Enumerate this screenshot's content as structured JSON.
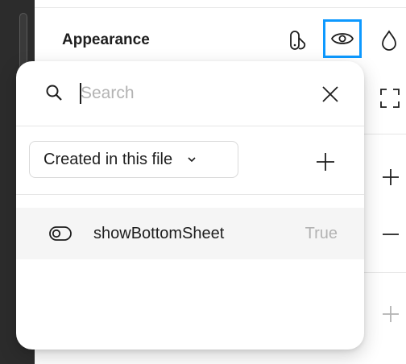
{
  "section": {
    "title": "Appearance"
  },
  "popover": {
    "search": {
      "placeholder": "Search",
      "value": ""
    },
    "filter": {
      "selected": "Created in this file"
    },
    "variables": [
      {
        "name": "showBottomSheet",
        "value": "True",
        "type_icon": "boolean-toggle-icon"
      }
    ]
  },
  "colors": {
    "accent": "#0d99ff",
    "row_highlight": "#f5f5f5",
    "canvas_dark": "#2c2c2c"
  }
}
